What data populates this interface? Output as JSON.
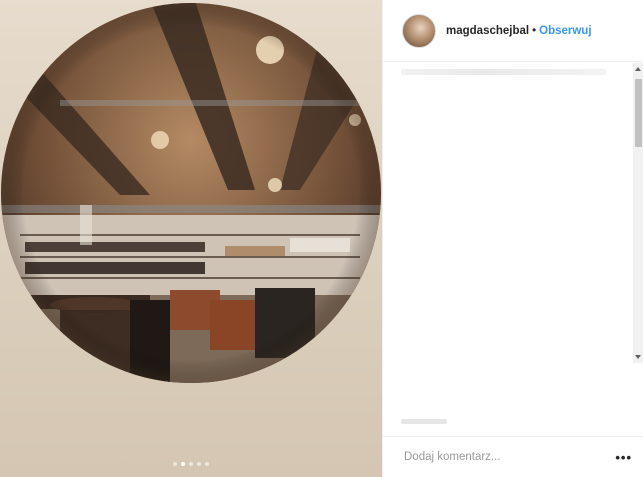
{
  "post": {
    "username": "magdaschejbal",
    "separator": "•",
    "follow_label": "Obserwuj",
    "carousel": {
      "total": 5,
      "active": 2
    }
  },
  "comment": {
    "placeholder": "Dodaj komentarz...",
    "more_label": "•••"
  },
  "colors": {
    "link_blue": "#3897f0",
    "text_dark": "#262626",
    "border": "#efefef"
  },
  "icons": [
    "more-options-icon"
  ]
}
